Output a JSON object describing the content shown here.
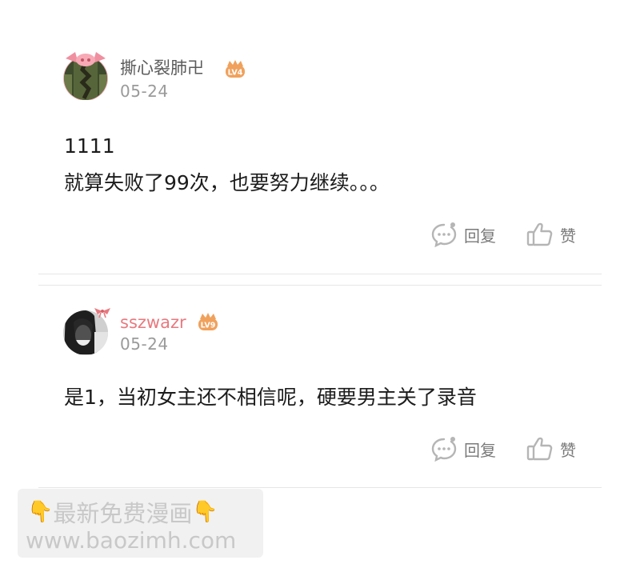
{
  "comments": [
    {
      "username": "撕心裂肺卍",
      "level": "LV4",
      "date": "05-24",
      "lines": [
        "1111",
        "就算失败了99次，也要努力继续。。。"
      ],
      "reply_label": "回复",
      "like_label": "赞"
    },
    {
      "username": "sszwazr",
      "level": "LV9",
      "date": "05-24",
      "lines": [
        "是1，当初女主还不相信呢，硬要男主关了录音"
      ],
      "reply_label": "回复",
      "like_label": "赞"
    }
  ],
  "watermark": {
    "line1": "最新免费漫画",
    "line2": "www.baozimh.com"
  },
  "colors": {
    "username_default": "#5a5a5a",
    "username_vip": "#e8797f",
    "level_badge": "#f0a15c"
  },
  "icons": [
    "pig-ears-icon",
    "bow-icon",
    "level-badge-icon",
    "reply-icon",
    "thumbs-up-icon",
    "pointing-down-hand-icon"
  ]
}
